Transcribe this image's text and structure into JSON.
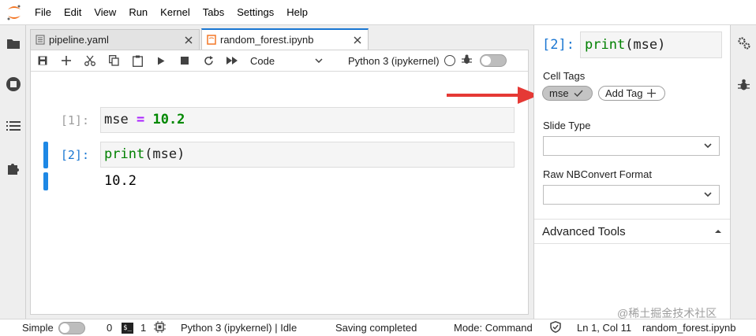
{
  "menubar": {
    "items": [
      "File",
      "Edit",
      "View",
      "Run",
      "Kernel",
      "Tabs",
      "Settings",
      "Help"
    ]
  },
  "left_sidebar": {
    "icons": [
      "folder-icon",
      "running-icon",
      "toc-icon",
      "extension-icon"
    ]
  },
  "tabs": [
    {
      "label": "pipeline.yaml",
      "icon": "file-text-icon",
      "active": false
    },
    {
      "label": "random_forest.ipynb",
      "icon": "notebook-icon",
      "active": true
    }
  ],
  "toolbar": {
    "cell_type": "Code",
    "kernel": "Python 3 (ipykernel)"
  },
  "cells": [
    {
      "prompt": "[1]:",
      "code_var": "mse",
      "code_op": "=",
      "code_num": "10.2"
    },
    {
      "prompt": "[2]:",
      "code_fn": "print",
      "code_args": "(mse)",
      "output": "10.2"
    }
  ],
  "property_inspector": {
    "prompt": "[2]:",
    "code_fn": "print",
    "code_args": "(mse)",
    "cell_tags_label": "Cell Tags",
    "tags": [
      "mse"
    ],
    "add_tag_label": "Add Tag",
    "slide_type_label": "Slide Type",
    "slide_type_value": "",
    "raw_format_label": "Raw NBConvert Format",
    "raw_format_value": "",
    "advanced_tools_label": "Advanced Tools"
  },
  "annotation": {
    "arrow_color": "#e53935"
  },
  "statusbar": {
    "mode_label": "Simple",
    "count_a": "0",
    "count_b": "1",
    "kernel_status": "Python 3 (ipykernel) | Idle",
    "save_status": "Saving completed",
    "mode": "Mode: Command",
    "position": "Ln 1, Col 11",
    "filename": "random_forest.ipynb"
  },
  "watermark": "@稀土掘金技术社区",
  "colors": {
    "accent": "#1976d2",
    "cell_bar": "#1e88e5",
    "logo": "#f37726"
  }
}
